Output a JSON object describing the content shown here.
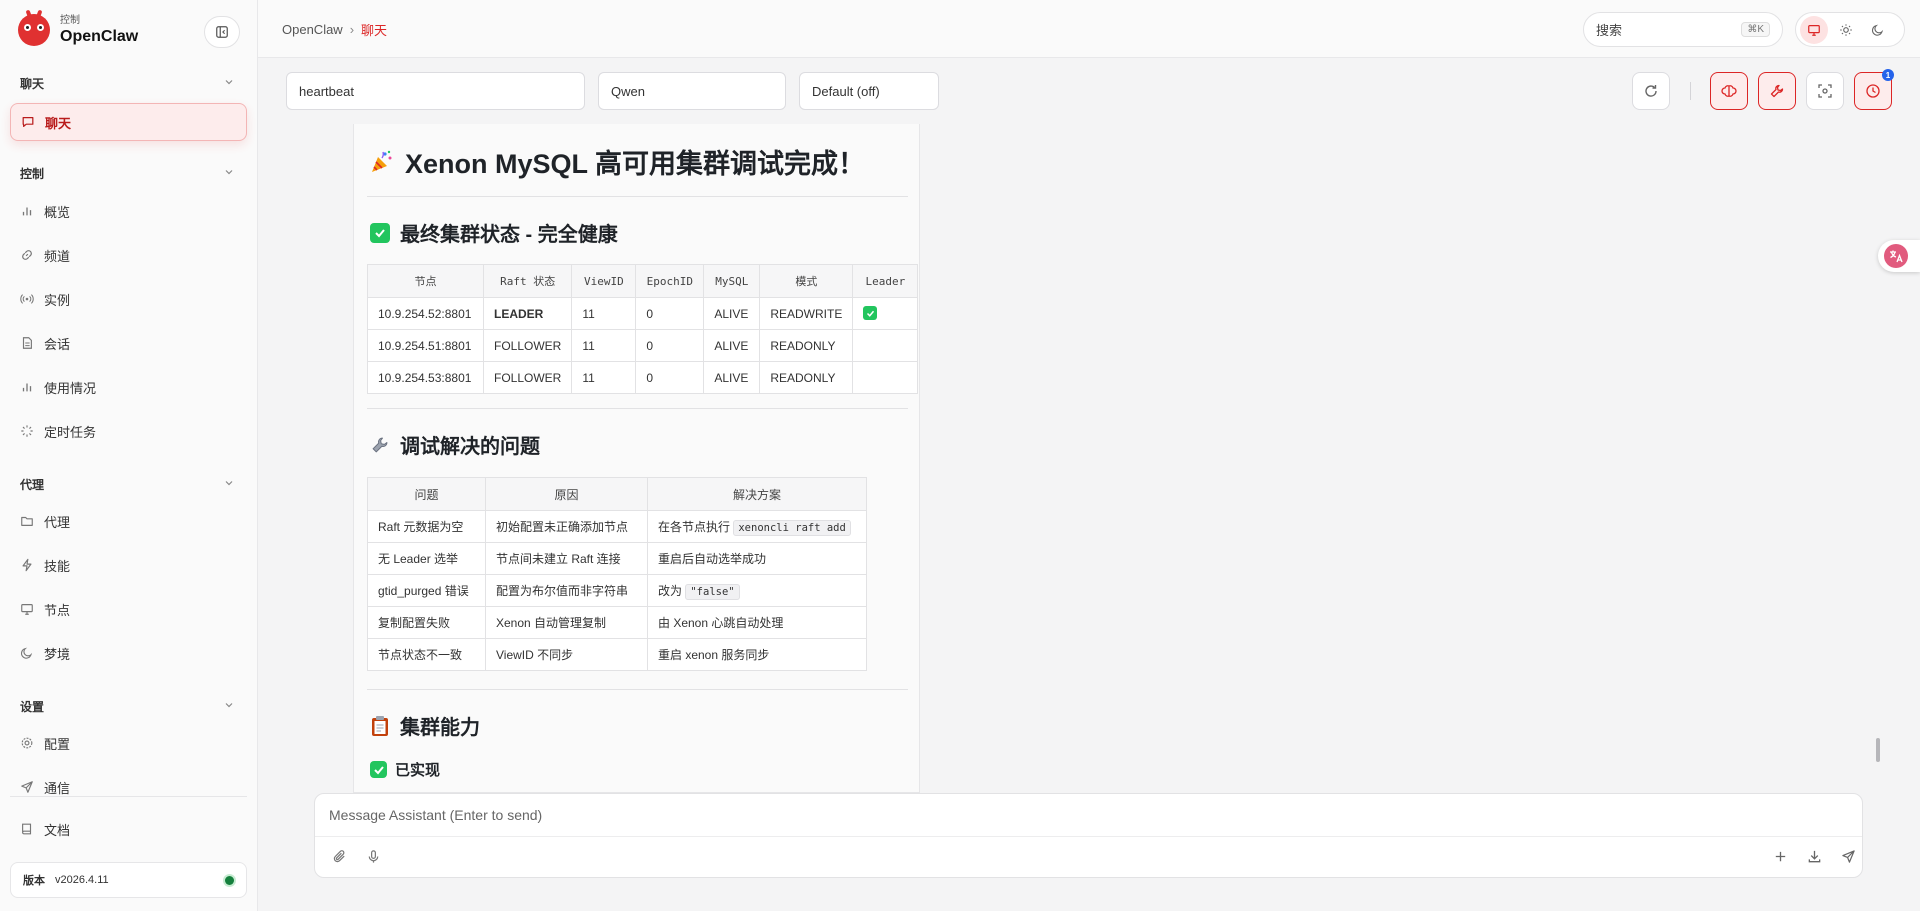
{
  "brand": {
    "subtitle": "控制",
    "name": "OpenClaw"
  },
  "sidebar": {
    "sections": [
      {
        "title": "聊天"
      },
      {
        "title": "控制"
      },
      {
        "title": "代理"
      },
      {
        "title": "设置"
      }
    ],
    "items": [
      {
        "label": "聊天",
        "icon": "chat-icon",
        "active": true
      },
      {
        "label": "概览",
        "icon": "bar-chart-icon"
      },
      {
        "label": "频道",
        "icon": "link-icon"
      },
      {
        "label": "实例",
        "icon": "radio-icon"
      },
      {
        "label": "会话",
        "icon": "document-icon"
      },
      {
        "label": "使用情况",
        "icon": "bar-chart-icon"
      },
      {
        "label": "定时任务",
        "icon": "loader-icon"
      },
      {
        "label": "代理",
        "icon": "folder-icon"
      },
      {
        "label": "技能",
        "icon": "lightning-icon"
      },
      {
        "label": "节点",
        "icon": "monitor-icon"
      },
      {
        "label": "梦境",
        "icon": "moon-icon"
      },
      {
        "label": "配置",
        "icon": "gear-icon"
      },
      {
        "label": "通信",
        "icon": "send-icon"
      },
      {
        "label": "文档",
        "icon": "book-icon"
      }
    ],
    "version": {
      "label": "版本",
      "value": "v2026.4.11",
      "status_color": "#15803d"
    }
  },
  "topbar": {
    "breadcrumb": [
      "OpenClaw",
      "聊天"
    ],
    "search": {
      "placeholder": "搜索",
      "shortcut": "⌘K"
    }
  },
  "toolbar": {
    "session": "heartbeat",
    "model": "Qwen",
    "thinking": "Default (off)",
    "notification_count": "1"
  },
  "message": {
    "title": "Xenon MySQL 高可用集群调试完成！",
    "status_heading": "最终集群状态 - 完全健康",
    "status_table": {
      "headers": [
        "节点",
        "Raft 状态",
        "ViewID",
        "EpochID",
        "MySQL",
        "模式",
        "Leader"
      ],
      "rows": [
        [
          "10.9.254.52:8801",
          "LEADER",
          "11",
          "0",
          "ALIVE",
          "READWRITE",
          "✅"
        ],
        [
          "10.9.254.51:8801",
          "FOLLOWER",
          "11",
          "0",
          "ALIVE",
          "READONLY",
          ""
        ],
        [
          "10.9.254.53:8801",
          "FOLLOWER",
          "11",
          "0",
          "ALIVE",
          "READONLY",
          ""
        ]
      ]
    },
    "issues_heading": "调试解决的问题",
    "issues_table": {
      "headers": [
        "问题",
        "原因",
        "解决方案"
      ],
      "rows": [
        {
          "problem": "Raft 元数据为空",
          "cause": "初始配置未正确添加节点",
          "fix_prefix": "在各节点执行",
          "fix_code": "xenoncli raft add"
        },
        {
          "problem": "无 Leader 选举",
          "cause": "节点间未建立 Raft 连接",
          "fix_prefix": "重启后自动选举成功",
          "fix_code": ""
        },
        {
          "problem": "gtid_purged 错误",
          "cause": "配置为布尔值而非字符串",
          "fix_prefix": "改为",
          "fix_code": "\"false\""
        },
        {
          "problem": "复制配置失败",
          "cause": "Xenon 自动管理复制",
          "fix_prefix": "由 Xenon 心跳自动处理",
          "fix_code": ""
        },
        {
          "problem": "节点状态不一致",
          "cause": "ViewID 不同步",
          "fix_prefix": "重启 xenon 服务同步",
          "fix_code": ""
        }
      ]
    },
    "capability_heading": "集群能力",
    "implemented_heading": "已实现"
  },
  "composer": {
    "placeholder": "Message Assistant (Enter to send)"
  },
  "colors": {
    "accent": "#dc2626",
    "success": "#22c55e"
  }
}
